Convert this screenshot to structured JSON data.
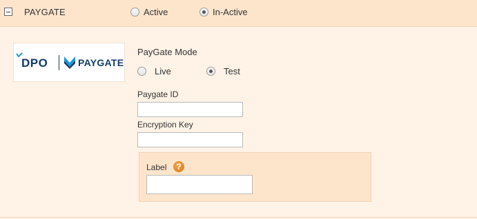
{
  "header": {
    "title": "PAYGATE",
    "status_options": [
      {
        "label": "Active",
        "checked": false
      },
      {
        "label": "In-Active",
        "checked": true
      }
    ]
  },
  "logo": {
    "brand_left": "DPO",
    "brand_right": "PAYGATE",
    "colors": {
      "primary": "#123a6b",
      "accent": "#1a9bd7"
    }
  },
  "mode": {
    "title": "PayGate Mode",
    "options": [
      {
        "label": "Live",
        "checked": false
      },
      {
        "label": "Test",
        "checked": true
      }
    ]
  },
  "fields": {
    "paygate_id_label": "Paygate ID",
    "paygate_id_value": "",
    "encryption_key_label": "Encryption Key",
    "encryption_key_value": "",
    "label_label": "Label",
    "label_value": "",
    "help_icon": "?"
  }
}
